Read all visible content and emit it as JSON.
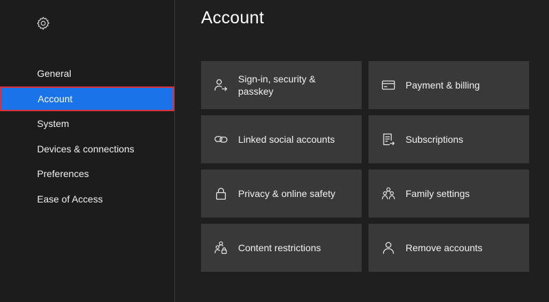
{
  "sidebar": {
    "settings_icon": "gear-icon",
    "items": [
      {
        "label": "General"
      },
      {
        "label": "Account",
        "selected": true
      },
      {
        "label": "System"
      },
      {
        "label": "Devices & connections"
      },
      {
        "label": "Preferences"
      },
      {
        "label": "Ease of Access"
      }
    ]
  },
  "main": {
    "title": "Account",
    "tiles": [
      {
        "label": "Sign-in, security & passkey",
        "icon": "person-arrow-icon"
      },
      {
        "label": "Payment & billing",
        "icon": "credit-card-icon"
      },
      {
        "label": "Linked social accounts",
        "icon": "link-icon"
      },
      {
        "label": "Subscriptions",
        "icon": "list-arrow-icon"
      },
      {
        "label": "Privacy & online safety",
        "icon": "lock-icon"
      },
      {
        "label": "Family settings",
        "icon": "family-icon"
      },
      {
        "label": "Content restrictions",
        "icon": "people-lock-icon"
      },
      {
        "label": "Remove accounts",
        "icon": "person-icon"
      }
    ]
  },
  "colors": {
    "background": "#1f1f1f",
    "tile": "#3a3939",
    "selected": "#1a73e8",
    "focus_outline": "#d9323c"
  }
}
